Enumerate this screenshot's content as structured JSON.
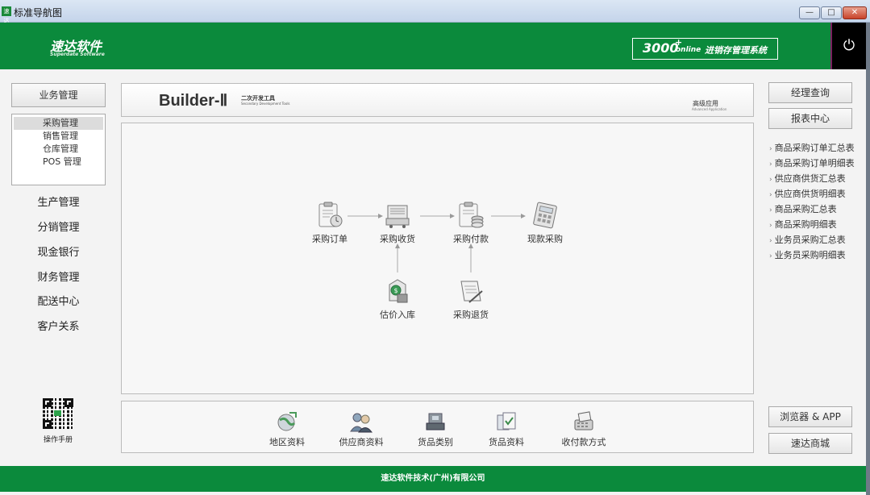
{
  "window": {
    "title": "标准导航图",
    "app_icon": "速达",
    "min": "—",
    "max": "□",
    "close": "✕"
  },
  "header": {
    "logo": "速达软件",
    "logo_sub": "Superdate Software",
    "product_version": "3000",
    "product_plus": "+",
    "product_edition": "online",
    "product_name": "进销存管理系统",
    "power_icon": "⏻",
    "accent_color": "#0b8a3c"
  },
  "sidebar": {
    "business_button": "业务管理",
    "submenu": [
      "采购管理",
      "销售管理",
      "仓库管理",
      "POS 管理"
    ],
    "active_submenu": "采购管理",
    "links": [
      "生产管理",
      "分销管理",
      "现金银行",
      "财务管理",
      "配送中心",
      "客户关系"
    ],
    "manual_label": "操作手册"
  },
  "banner": {
    "brand": "Builder-Ⅱ",
    "brand_cn": "二次开发工具",
    "brand_en": "Secondary Development Tools",
    "advanced_cn": "高级应用",
    "advanced_en": "Advanced Application"
  },
  "flow": {
    "purchase_order": "采购订单",
    "purchase_receipt": "采购收货",
    "purchase_payment": "采购付款",
    "cash_purchase": "现款采购",
    "estimated_stock_in": "估价入库",
    "purchase_return": "采购退货"
  },
  "tools": [
    "地区资料",
    "供应商资料",
    "货品类别",
    "货品资料",
    "收付款方式"
  ],
  "right_panel": {
    "manager_query": "经理查询",
    "report_center": "报表中心",
    "reports": [
      "商品采购订单汇总表",
      "商品采购订单明细表",
      "供应商供货汇总表",
      "供应商供货明细表",
      "商品采购汇总表",
      "商品采购明细表",
      "业务员采购汇总表",
      "业务员采购明细表"
    ],
    "browser_app": "浏览器 & APP",
    "mall": "速达商城"
  },
  "footer": {
    "company": "速达软件技术(广州)有限公司"
  }
}
